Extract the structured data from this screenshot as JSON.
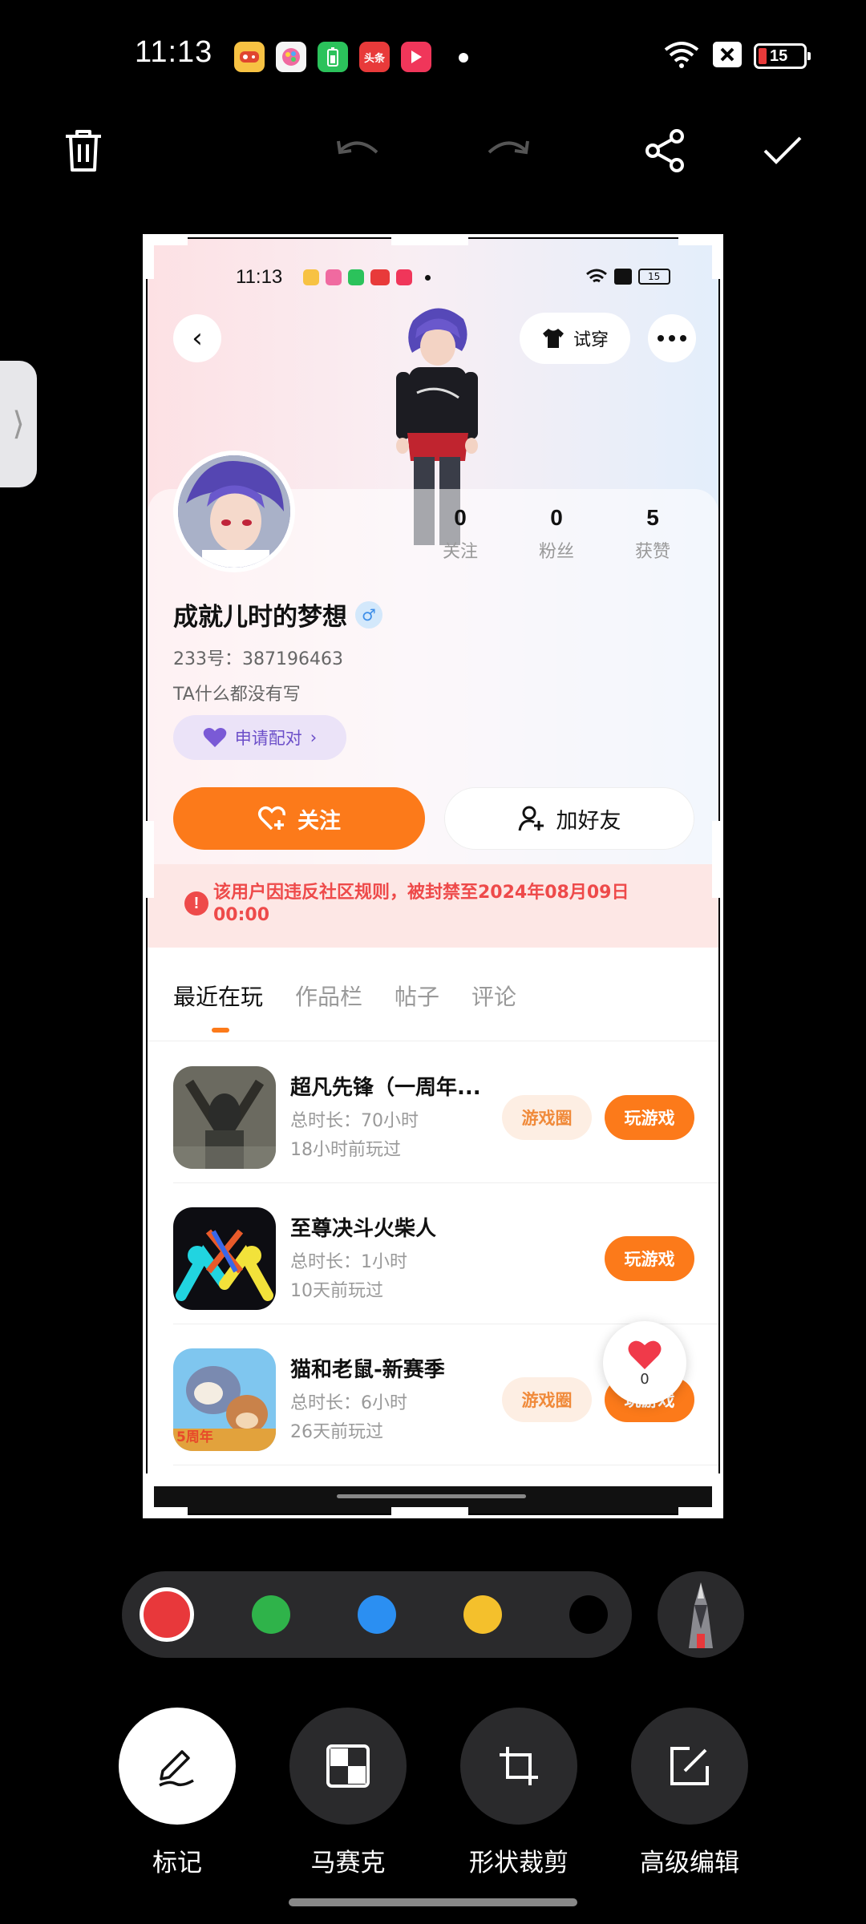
{
  "status_bar": {
    "time": "11:13",
    "battery": "15",
    "app_icons": [
      {
        "name": "game-app-icon",
        "text": "",
        "color": "#f7c243"
      },
      {
        "name": "paint-app-icon",
        "text": "",
        "color": "#f06aa0"
      },
      {
        "name": "battery-app-icon",
        "text": "",
        "color": "#2bc25b"
      },
      {
        "name": "toutiao-app-icon",
        "text": "头条",
        "color": "#e83a3a"
      },
      {
        "name": "video-app-icon",
        "text": "▶",
        "color": "#f0365a"
      }
    ]
  },
  "toolbar": {
    "icons": [
      "delete-icon",
      "undo-icon",
      "redo-icon",
      "share-icon",
      "confirm-icon"
    ]
  },
  "preview": {
    "status_time": "11:13",
    "try_on": "试穿",
    "stats": [
      {
        "value": "0",
        "label": "关注"
      },
      {
        "value": "0",
        "label": "粉丝"
      },
      {
        "value": "5",
        "label": "获赞"
      }
    ],
    "name": "成就儿时的梦想",
    "gender_symbol": "♂",
    "id_text": "233号：387196463",
    "bio": "TA什么都没有写",
    "pair_label": "申请配对",
    "follow_label": "关注",
    "add_friend_label": "加好友",
    "ban_notice": "该用户因违反社区规则，被封禁至2024年08月09日00:00",
    "tabs": [
      "最近在玩",
      "作品栏",
      "帖子",
      "评论"
    ],
    "games": [
      {
        "name": "超凡先锋（一周年...",
        "duration": "总时长：70小时",
        "last_played": "18小时前玩过",
        "circle_label": "游戏圈",
        "play_label": "玩游戏"
      },
      {
        "name": "至尊决斗火柴人",
        "duration": "总时长：1小时",
        "last_played": "10天前玩过",
        "circle_label": "",
        "play_label": "玩游戏"
      },
      {
        "name": "猫和老鼠-新赛季",
        "duration": "总时长：6小时",
        "last_played": "26天前玩过",
        "circle_label": "游戏圈",
        "play_label": "玩游戏"
      }
    ],
    "like_count": "0",
    "game3_badge": "5周年"
  },
  "palette": {
    "colors": [
      "#e8383b",
      "#2fb34a",
      "#2b8ff2",
      "#f4c02c",
      "#000000"
    ],
    "selected": 0
  },
  "tools": [
    {
      "label": "标记",
      "icon": "pencil-icon"
    },
    {
      "label": "马赛克",
      "icon": "mosaic-icon"
    },
    {
      "label": "形状裁剪",
      "icon": "crop-icon"
    },
    {
      "label": "高级编辑",
      "icon": "edit-icon"
    }
  ]
}
